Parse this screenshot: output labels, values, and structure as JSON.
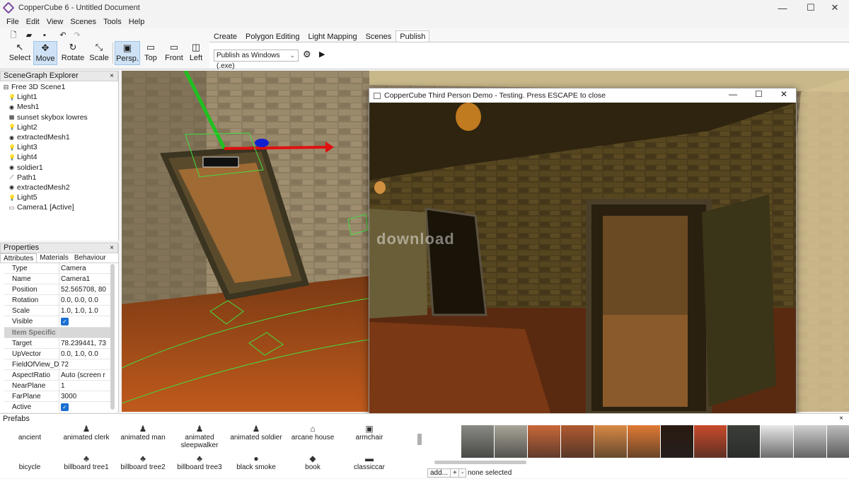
{
  "window": {
    "title": "CopperCube 6 - Untitled Document",
    "controls": [
      "—",
      "☐",
      "✕"
    ]
  },
  "menu": [
    "File",
    "Edit",
    "View",
    "Scenes",
    "Tools",
    "Help"
  ],
  "toolbar": {
    "tools": [
      {
        "label": "Select",
        "icon": "↖"
      },
      {
        "label": "Move",
        "icon": "✥"
      },
      {
        "label": "Rotate",
        "icon": "↻"
      },
      {
        "label": "Scale",
        "icon": "⤡"
      }
    ],
    "views": [
      {
        "label": "Persp.",
        "icon": "▣"
      },
      {
        "label": "Top",
        "icon": "▭"
      },
      {
        "label": "Front",
        "icon": "▭"
      },
      {
        "label": "Left",
        "icon": "◫"
      }
    ],
    "tabs": [
      "Create",
      "Polygon Editing",
      "Light Mapping",
      "Scenes",
      "Publish"
    ],
    "active_tab": "Publish",
    "publish_target": "Publish as Windows (.exe)"
  },
  "scenegraph": {
    "title": "SceneGraph Explorer",
    "root": "Free 3D Scene1",
    "items": [
      {
        "label": "Light1",
        "icon": "💡"
      },
      {
        "label": "Mesh1",
        "icon": "◉"
      },
      {
        "label": "sunset skybox lowres",
        "icon": "▦"
      },
      {
        "label": "Light2",
        "icon": "💡"
      },
      {
        "label": "extractedMesh1",
        "icon": "◉"
      },
      {
        "label": "Light3",
        "icon": "💡"
      },
      {
        "label": "Light4",
        "icon": "💡"
      },
      {
        "label": "soldier1",
        "icon": "◉"
      },
      {
        "label": "Path1",
        "icon": "⟋"
      },
      {
        "label": "extractedMesh2",
        "icon": "◉"
      },
      {
        "label": "Light5",
        "icon": "💡"
      },
      {
        "label": "Camera1 [Active]",
        "icon": "▭"
      }
    ]
  },
  "properties": {
    "title": "Properties",
    "tabs": [
      "Attributes",
      "Materials",
      "Behaviour"
    ],
    "rows": [
      {
        "k": "Type",
        "v": "Camera"
      },
      {
        "k": "Name",
        "v": "Camera1"
      },
      {
        "k": "Position",
        "v": "52.565708, 80"
      },
      {
        "k": "Rotation",
        "v": "0.0, 0.0, 0.0"
      },
      {
        "k": "Scale",
        "v": "1.0, 1.0, 1.0"
      },
      {
        "k": "Visible",
        "v": "",
        "checked": true
      },
      {
        "k": "Item Specific",
        "v": "",
        "section": true
      },
      {
        "k": "Target",
        "v": "78.239441, 73"
      },
      {
        "k": "UpVector",
        "v": "0.0, 1.0, 0.0"
      },
      {
        "k": "FieldOfView_Degre",
        "v": "72"
      },
      {
        "k": "AspectRatio",
        "v": "Auto (screen r"
      },
      {
        "k": "NearPlane",
        "v": "1"
      },
      {
        "k": "FarPlane",
        "v": "3000"
      },
      {
        "k": "Active",
        "v": "",
        "checked": true
      }
    ]
  },
  "preview": {
    "title": "CopperCube Third Person Demo - Testing. Press ESCAPE to close",
    "watermark": "download"
  },
  "prefabs": {
    "title": "Prefabs",
    "row1": [
      "ancient",
      "animated clerk",
      "animated man",
      "animated sleepwalker",
      "animated soldier",
      "arcane house",
      "armchair"
    ],
    "row2": [
      "bicycle",
      "billboard tree1",
      "billboard tree2",
      "billboard tree3",
      "black smoke",
      "book",
      "classiccar"
    ]
  },
  "textures": {
    "add_label": "add...",
    "plus": "+",
    "minus": "-",
    "status": "none selected",
    "swatches": [
      "#8a8a84",
      "#a8a498",
      "#c8683a",
      "#b05a30",
      "#d88a44",
      "#e07a34",
      "#2a1a10",
      "#c84a2a",
      "#3a3e38",
      "#e8e8e8",
      "#d0d0d0",
      "#bcbcbc"
    ]
  }
}
